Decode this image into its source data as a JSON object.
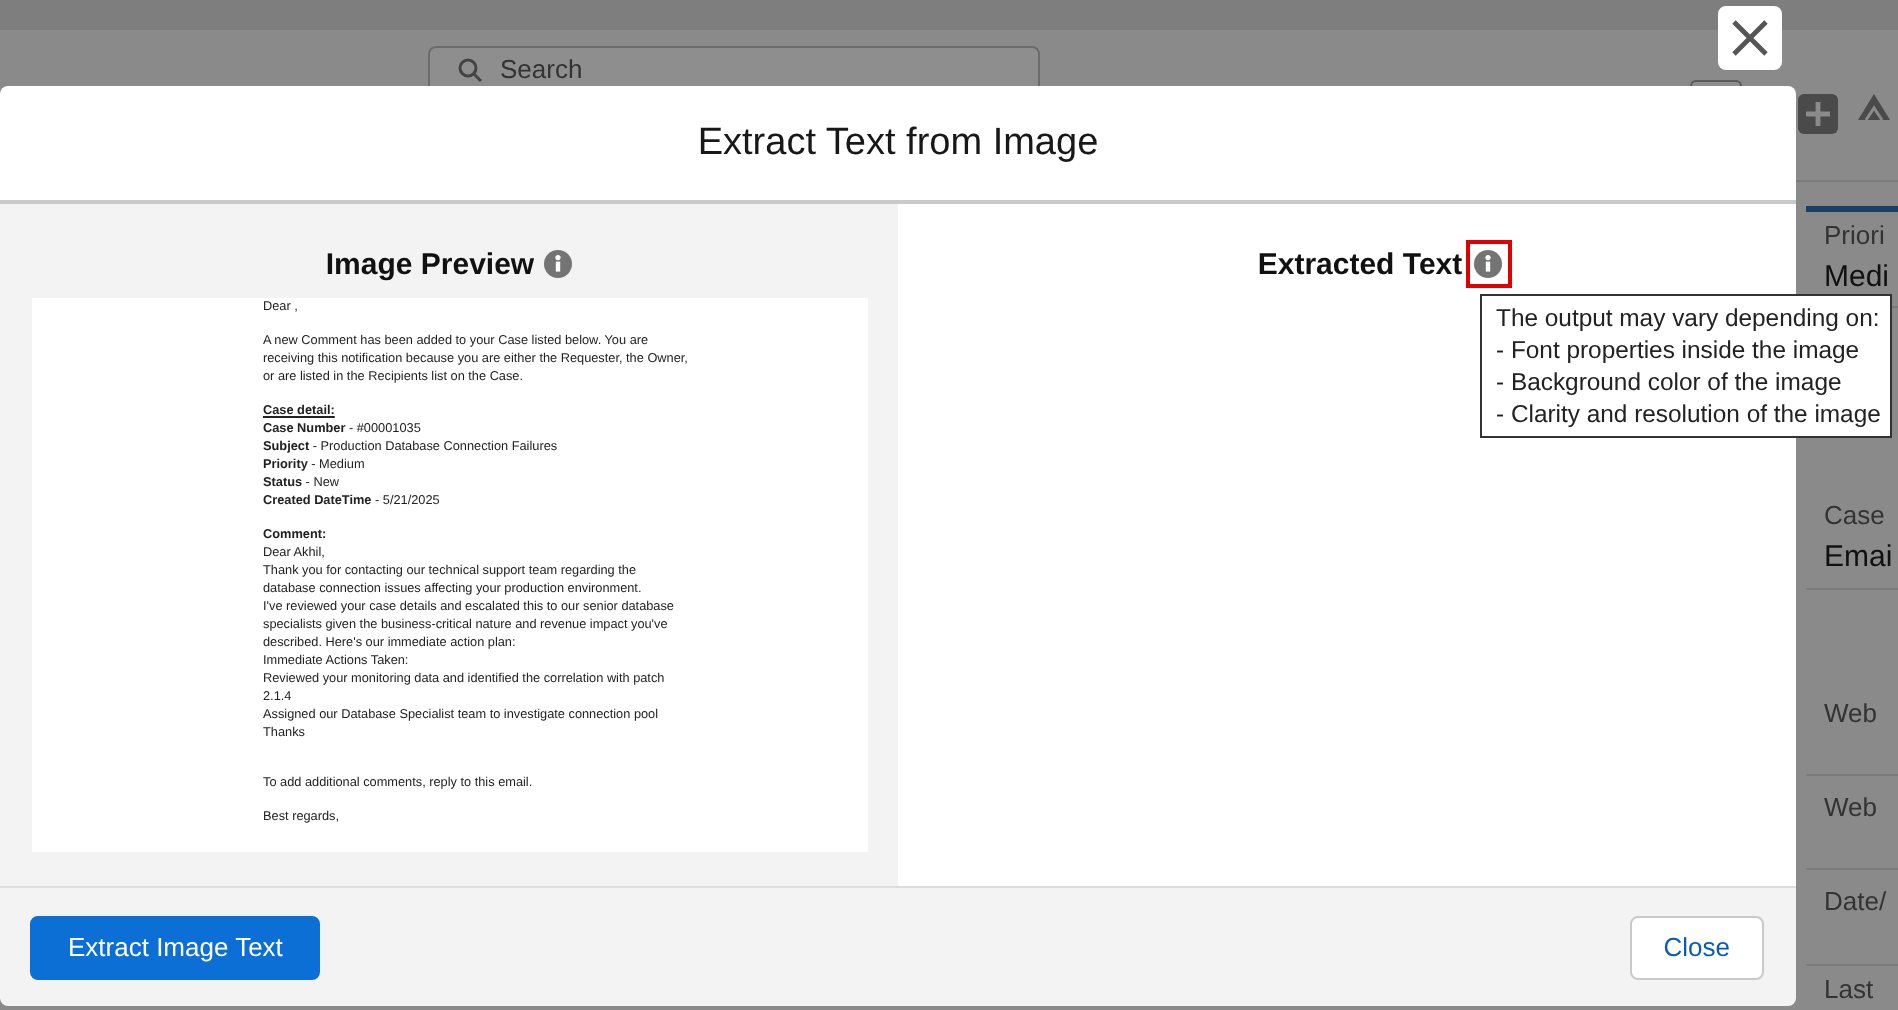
{
  "background": {
    "search": {
      "placeholder": "Search"
    },
    "fields": [
      {
        "label": "Priori",
        "value": "Medi"
      },
      {
        "label": "Case",
        "value": "Emai"
      },
      {
        "label": "Web"
      },
      {
        "label": "Web"
      },
      {
        "label": "Date/"
      },
      {
        "label": "Last"
      }
    ]
  },
  "modal": {
    "title": "Extract Text from Image",
    "preview": {
      "heading": "Image Preview",
      "email": [
        {
          "kind": "text",
          "lines": [
            "Dear ,"
          ]
        },
        {
          "kind": "text",
          "lines": [
            "A new Comment has been added to your Case listed below. You are",
            "receiving this notification because you are either the Requester, the Owner,",
            "or are listed in the Recipients list on the Case."
          ]
        },
        {
          "kind": "heading",
          "lines": [
            "Case detail:"
          ]
        },
        {
          "kind": "text",
          "lines": [
            "**Case Number** - #00001035",
            "**Subject** - Production Database Connection Failures",
            "**Priority** - Medium",
            "**Status** - New",
            "**Created DateTime** - 5/21/2025"
          ]
        },
        {
          "kind": "strong",
          "lines": [
            "Comment:"
          ]
        },
        {
          "kind": "text",
          "lines": [
            "Dear Akhil,",
            "Thank you for contacting our technical support team regarding the",
            "database connection issues affecting your production environment.",
            "I've reviewed your case details and escalated this to our senior database",
            "specialists given the business-critical nature and revenue impact you've",
            "described. Here's our immediate action plan:",
            "Immediate Actions Taken:",
            "Reviewed your monitoring data and identified the correlation with patch",
            "2.1.4",
            "Assigned our Database Specialist team to investigate connection pool",
            "Thanks"
          ]
        },
        {
          "kind": "spacer"
        },
        {
          "kind": "text",
          "lines": [
            "To add additional comments, reply to this email."
          ]
        },
        {
          "kind": "text",
          "lines": [
            "Best regards,"
          ]
        }
      ]
    },
    "extracted": {
      "heading": "Extracted Text",
      "highlighted": true,
      "tooltip": [
        "The output may vary depending on:",
        "- Font properties inside the image",
        "- Background color of the image",
        "- Clarity and resolution of the image"
      ]
    },
    "buttons": [
      {
        "label": "Extract Image Text",
        "kind": "brand"
      },
      {
        "label": "Close",
        "kind": "neutral"
      }
    ]
  }
}
